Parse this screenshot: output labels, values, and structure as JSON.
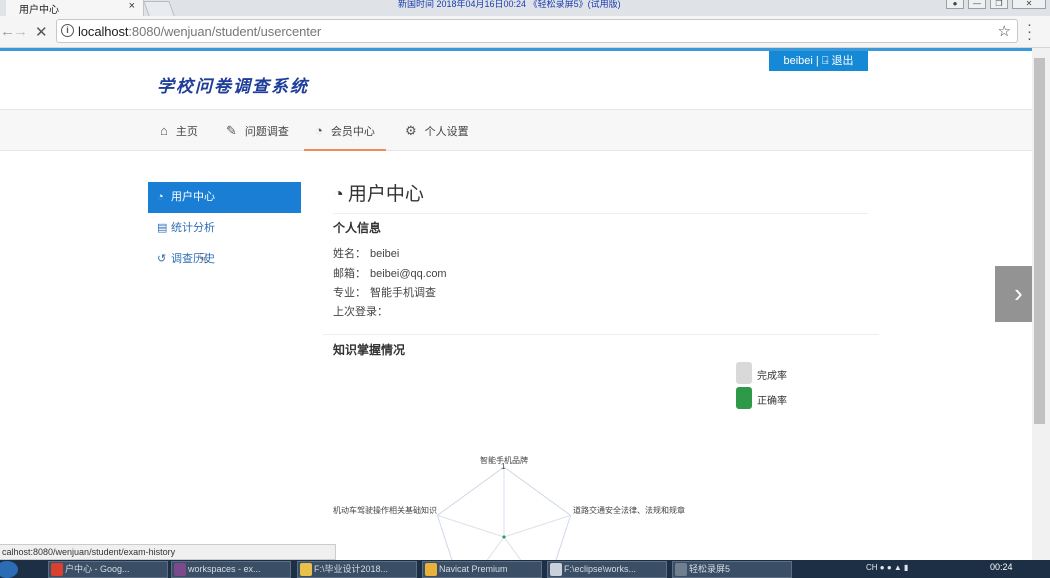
{
  "browser": {
    "tab_title": "用户中心",
    "tab_close": "×",
    "recording_banner": "新国时间 2018年04月16日00:24 《轻松录屏5》(试用版)",
    "url_host": "localhost",
    "url_rest": ":8080/wenjuan/student/usercenter",
    "status_url": "calhost:8080/wenjuan/student/exam-history",
    "icons": {
      "back": "arrow-left-icon",
      "forward": "arrow-right-icon",
      "stop": "close-icon",
      "info": "info-icon",
      "bookmark": "star-icon",
      "menu": "kebab-menu-icon"
    }
  },
  "header": {
    "logo": "学校问卷调查系统",
    "user_button": "beibei | ⍈ 退出"
  },
  "nav": {
    "items": [
      {
        "label": "主页",
        "icon": "home-icon"
      },
      {
        "label": "问题调查",
        "icon": "edit-icon"
      },
      {
        "label": "会员中心",
        "icon": "dashboard-icon"
      },
      {
        "label": "个人设置",
        "icon": "gears-icon"
      }
    ],
    "active_index": 2
  },
  "sidebar": {
    "items": [
      {
        "label": "用户中心",
        "icon": "dashboard-icon"
      },
      {
        "label": "统计分析",
        "icon": "bar-chart-icon"
      },
      {
        "label": "调查历史",
        "icon": "history-icon"
      }
    ],
    "active_index": 0
  },
  "main": {
    "title": "用户中心",
    "personal_info_heading": "个人信息",
    "fields": [
      {
        "label": "姓名：",
        "value": "beibei"
      },
      {
        "label": "邮箱：",
        "value": "beibei@qq.com"
      },
      {
        "label": "专业：",
        "value": "智能手机调查"
      },
      {
        "label": "上次登录：",
        "value": ""
      }
    ],
    "knowledge_heading": "知识掌握情况"
  },
  "chart_data": {
    "type": "radar",
    "legend": [
      {
        "name": "完成率",
        "color": "#d9d9d9"
      },
      {
        "name": "正确率",
        "color": "#2e9a49"
      }
    ],
    "indicators": [
      "智能手机品牌",
      "道路交通安全法律、法规和规章",
      "机动车驾驶操作相关基础知识"
    ],
    "top_axis_tick": "1",
    "series": [
      {
        "name": "完成率",
        "values": [
          0,
          0,
          0
        ]
      },
      {
        "name": "正确率",
        "values": [
          0,
          0,
          0
        ]
      }
    ]
  },
  "taskbar": {
    "tasks": [
      {
        "label": "户中心 - Goog...",
        "color": "#d9412e"
      },
      {
        "label": "workspaces - ex...",
        "color": "#7a4a8a"
      },
      {
        "label": "F:\\毕业设计2018...",
        "color": "#e8c04a"
      },
      {
        "label": "Navicat Premium",
        "color": "#e8b23a"
      },
      {
        "label": "F:\\eclipse\\works...",
        "color": "#c9d2da"
      },
      {
        "label": "轻松录屏5",
        "color": "#6f7f8f"
      }
    ],
    "tray": "CH",
    "clock": "00:24"
  }
}
